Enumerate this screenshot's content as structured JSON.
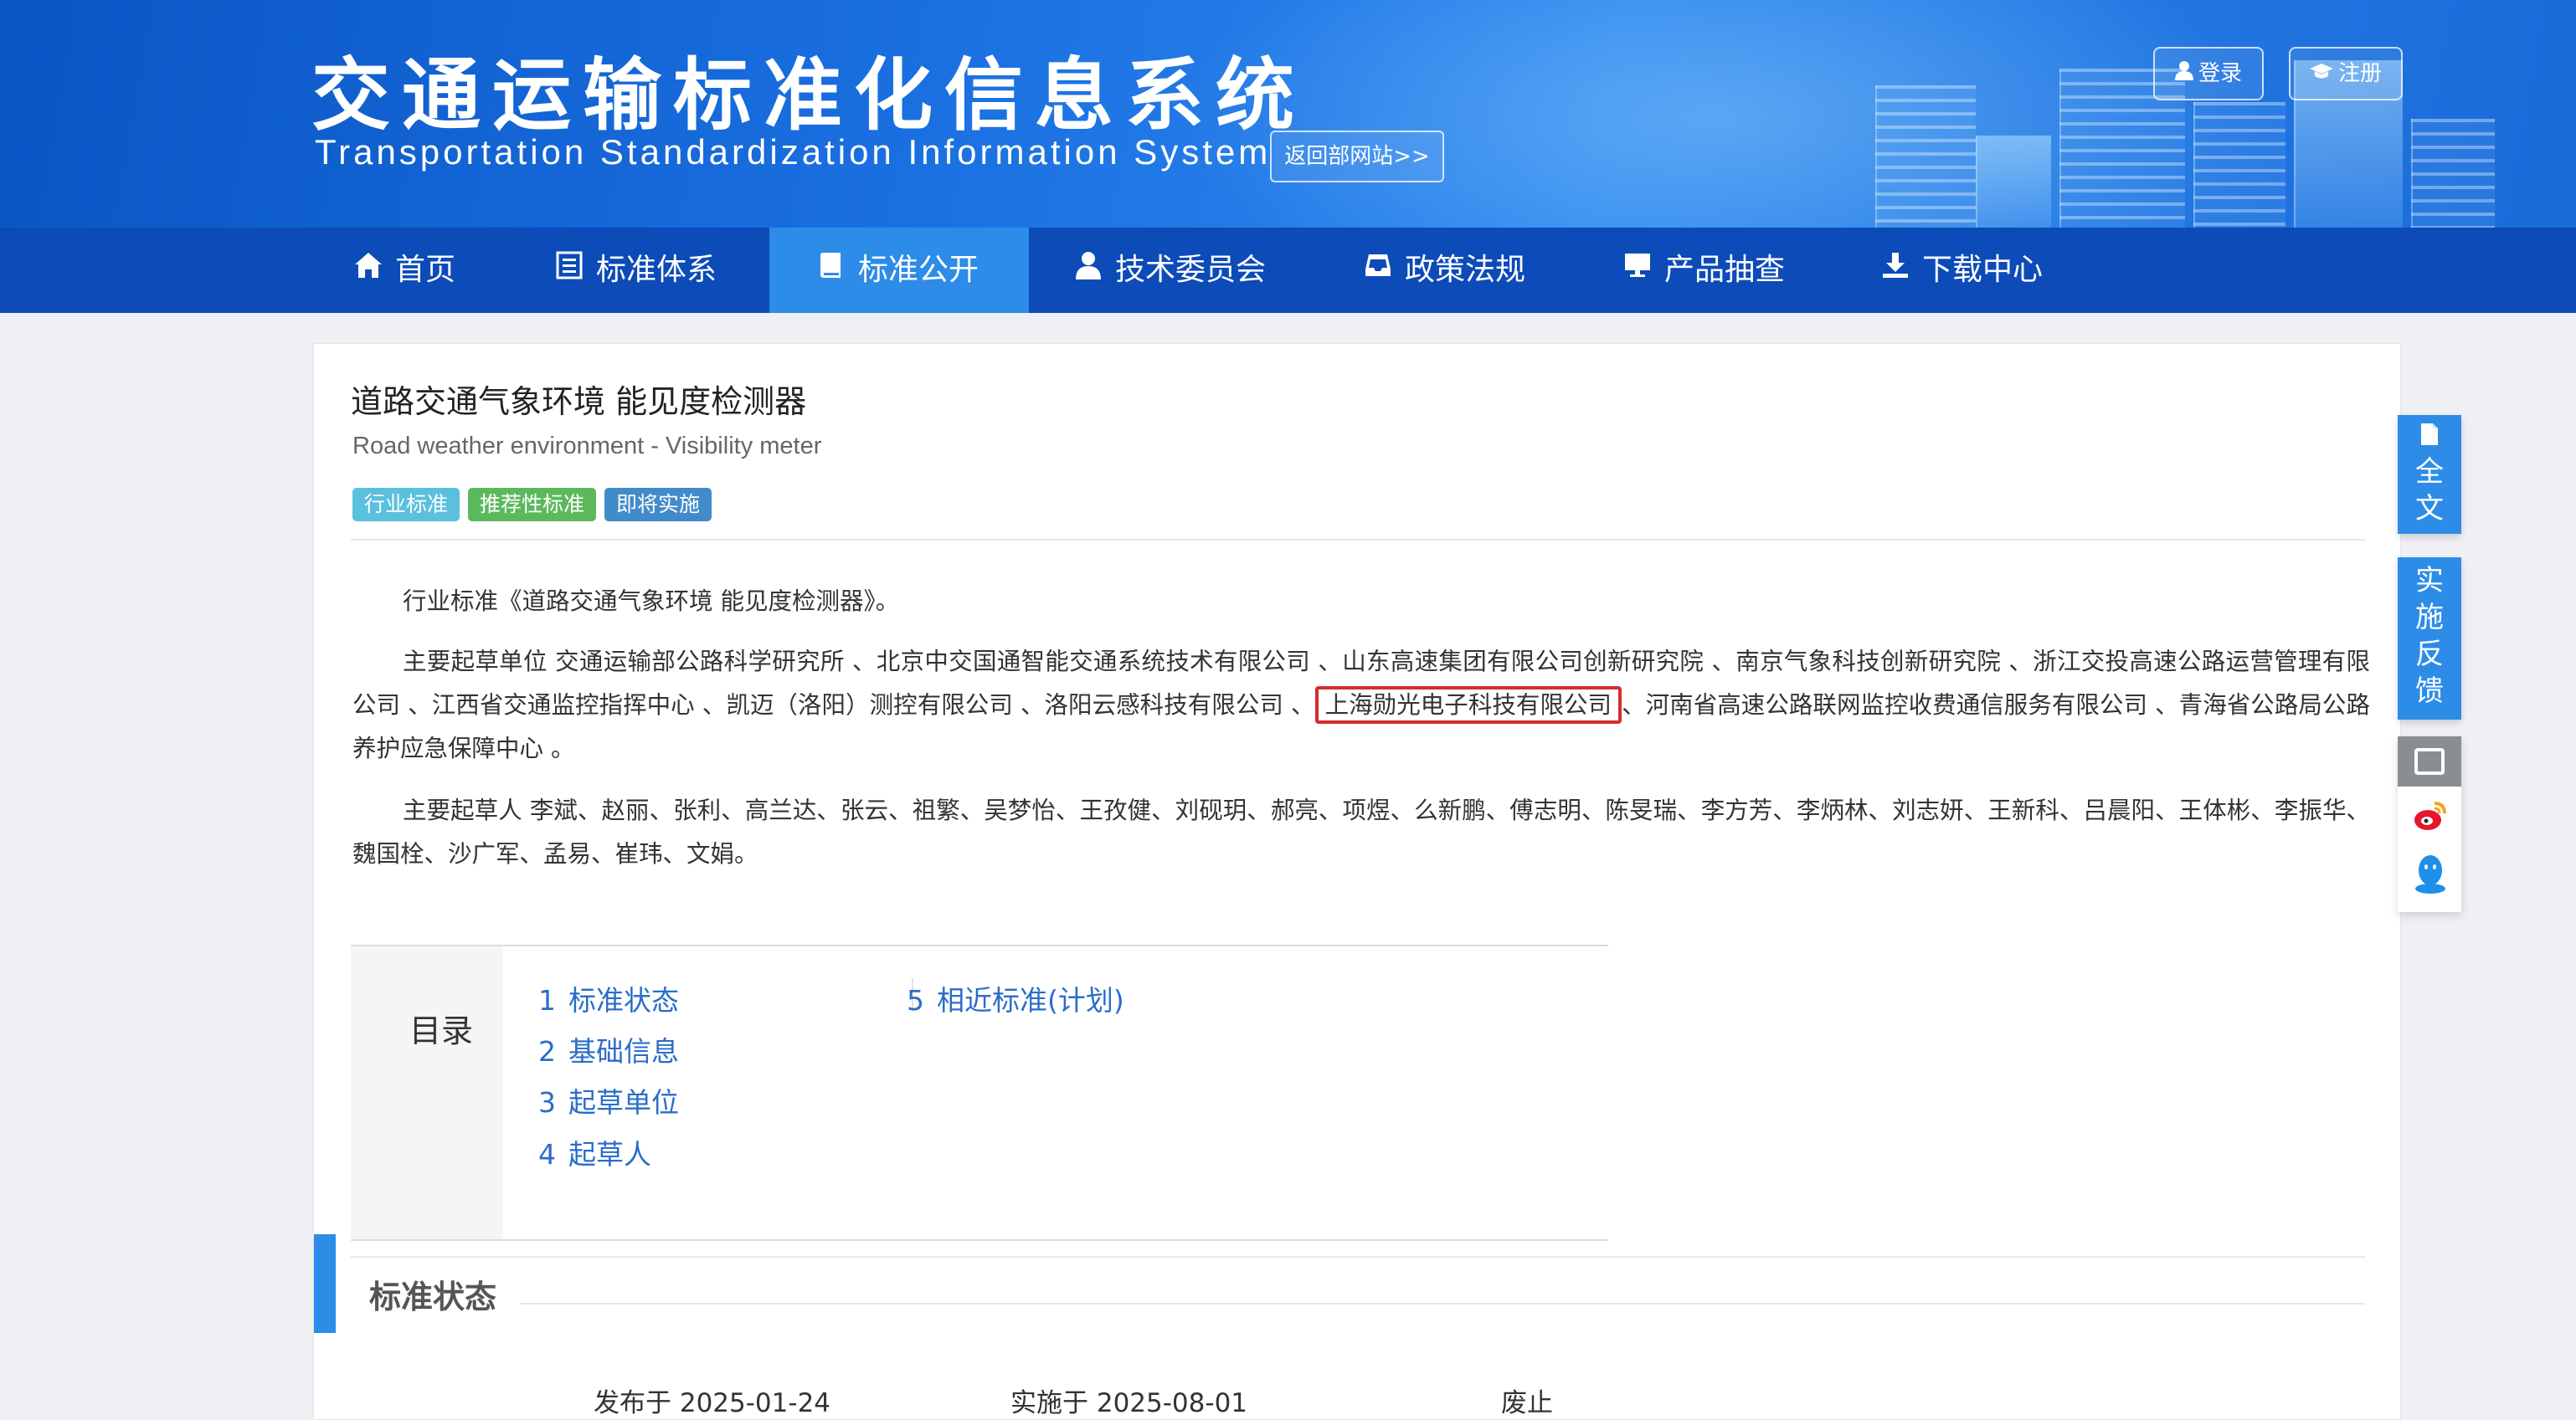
{
  "header": {
    "title": "交通运输标准化信息系统",
    "subtitle": "Transportation Standardization Information System",
    "back_link": "返回部网站>>",
    "login": "登录",
    "register": "注册"
  },
  "nav": {
    "items": [
      {
        "label": "首页",
        "icon": "home-icon"
      },
      {
        "label": "标准体系",
        "icon": "list-icon"
      },
      {
        "label": "标准公开",
        "icon": "book-icon",
        "active": true
      },
      {
        "label": "技术委员会",
        "icon": "user-icon"
      },
      {
        "label": "政策法规",
        "icon": "inbox-icon"
      },
      {
        "label": "产品抽查",
        "icon": "monitor-icon"
      },
      {
        "label": "下载中心",
        "icon": "download-icon"
      }
    ]
  },
  "standard": {
    "title": "道路交通气象环境 能见度检测器",
    "title_en": "Road weather environment - Visibility meter",
    "tags": [
      "行业标准",
      "推荐性标准",
      "即将实施"
    ],
    "intro": "行业标准《道路交通气象环境 能见度检测器》。",
    "drafting_units_before": "主要起草单位 交通运输部公路科学研究所 、北京中交国通智能交通系统技术有限公司 、山东高速集团有限公司创新研究院 、南京气象科技创新研究院 、浙江交投高速公路运营管理有限公司 、江西省交通监控指挥中心 、凯迈（洛阳）测控有限公司 、洛阳云感科技有限公司 、",
    "drafting_units_highlight": "上海勋光电子科技有限公司",
    "drafting_units_after": "、河南省高速公路联网监控收费通信服务有限公司 、青海省公路局公路养护应急保障中心 。",
    "drafters": "主要起草人 李斌、赵丽、张利、高兰达、张云、祖繁、吴梦怡、王孜健、刘砚玥、郝亮、项煜、么新鹏、傅志明、陈旻瑞、李方芳、李炳林、刘志妍、王新科、吕晨阳、王体彬、李振华、魏国栓、沙广军、孟易、崔玮、文娟。"
  },
  "catalog": {
    "label": "目录",
    "items": [
      {
        "num": "1",
        "label": "标准状态"
      },
      {
        "num": "2",
        "label": "基础信息"
      },
      {
        "num": "3",
        "label": "起草单位"
      },
      {
        "num": "4",
        "label": "起草人"
      },
      {
        "num": "5",
        "label": "相近标准(计划)"
      }
    ]
  },
  "status_section": {
    "title": "标准状态",
    "published": "发布于 2025-01-24",
    "effective": "实施于 2025-08-01",
    "abolished": "废止"
  },
  "side": {
    "fulltext": [
      "全",
      "文"
    ],
    "feedback": [
      "实",
      "施",
      "反",
      "馈"
    ]
  },
  "colors": {
    "nav_bg": "#0c4bb8",
    "nav_active": "#2c8ce8",
    "highlight_border": "#d42d2d",
    "link": "#2a6dc8"
  }
}
